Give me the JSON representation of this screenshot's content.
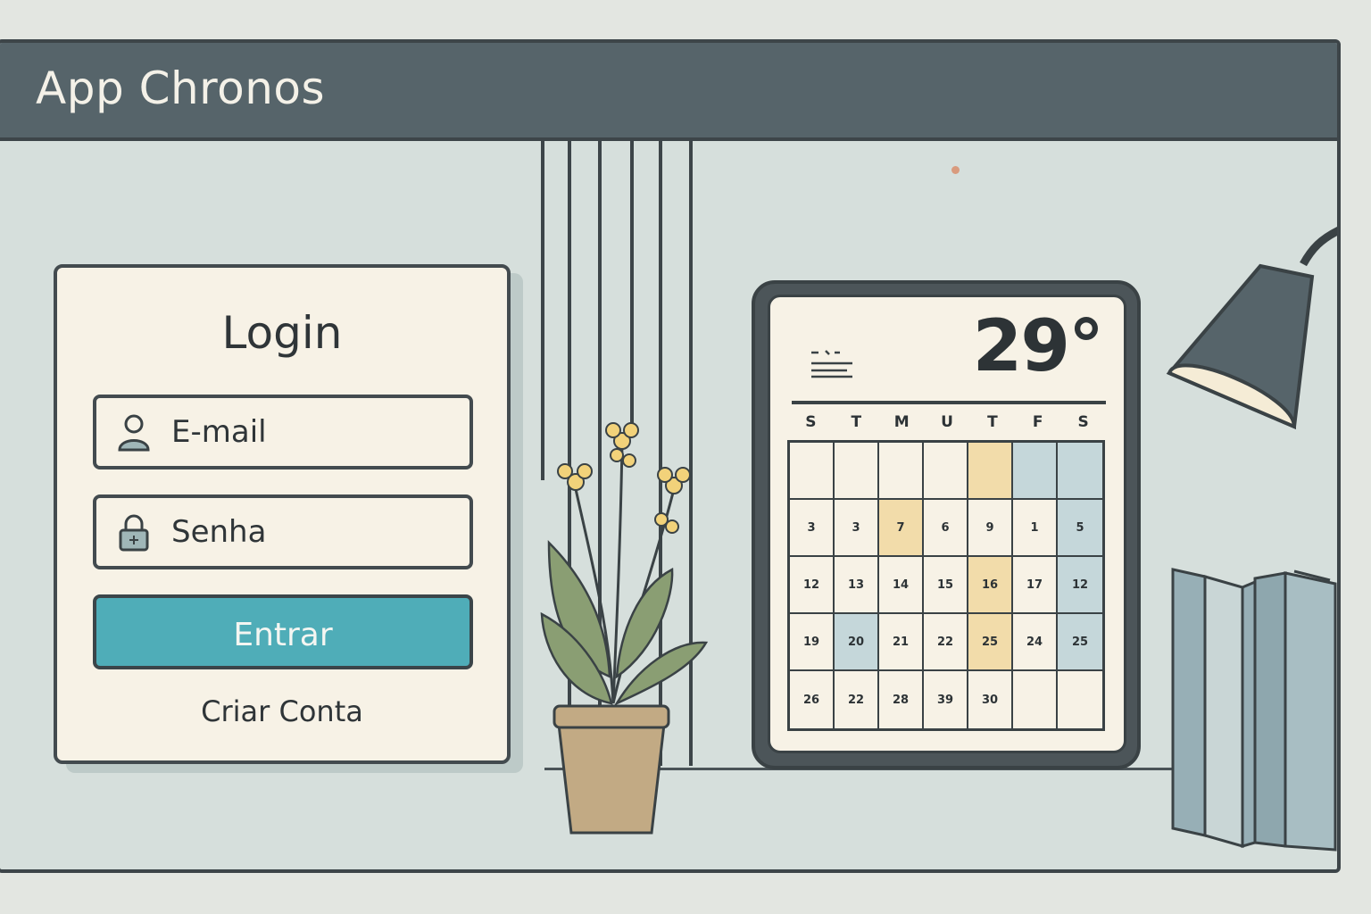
{
  "window": {
    "title": "App Chronos"
  },
  "login": {
    "title": "Login",
    "email_placeholder": "E-mail",
    "password_placeholder": "Senha",
    "submit_label": "Entrar",
    "create_account_label": "Criar Conta"
  },
  "calendar_widget": {
    "temperature": "29°",
    "weekdays": [
      "S",
      "T",
      "M",
      "U",
      "T",
      "F",
      "S"
    ],
    "rows": [
      [
        "",
        "",
        "",
        "",
        "",
        "",
        ""
      ],
      [
        "3",
        "3",
        "7",
        "6",
        "9",
        "1",
        "5"
      ],
      [
        "12",
        "13",
        "14",
        "15",
        "16",
        "17",
        "12"
      ],
      [
        "19",
        "20",
        "21",
        "22",
        "25",
        "24",
        "25"
      ],
      [
        "26",
        "22",
        "28",
        "39",
        "30",
        "",
        ""
      ]
    ],
    "highlights": {
      "yellow": [
        [
          0,
          4
        ],
        [
          1,
          2
        ],
        [
          2,
          4
        ],
        [
          3,
          4
        ]
      ],
      "blue": [
        [
          0,
          5
        ],
        [
          0,
          6
        ],
        [
          1,
          6
        ],
        [
          2,
          6
        ],
        [
          3,
          6
        ],
        [
          3,
          1
        ]
      ]
    }
  },
  "colors": {
    "titlebar": "#56646a",
    "accent_button": "#4fadb8",
    "card_background": "#f7f2e6",
    "highlight_yellow": "#f2dcaa",
    "highlight_blue": "#c5d7da"
  },
  "icons": [
    "user-icon",
    "lock-icon",
    "menu-icon",
    "lamp-icon",
    "plant-icon",
    "books-icon"
  ]
}
